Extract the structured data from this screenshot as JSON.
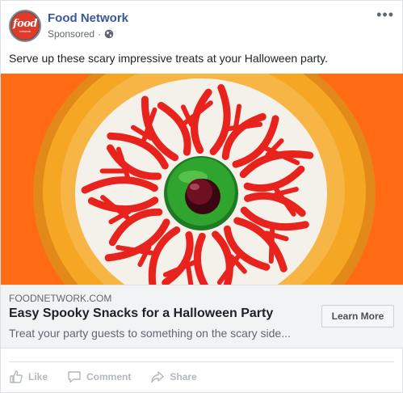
{
  "post": {
    "page_name": "Food Network",
    "sponsored": "Sponsored",
    "separator": "·",
    "caption": "Serve up these scary impressive treats at your Halloween party.",
    "avatar_logo": "food",
    "avatar_sub": "network",
    "more_label": "•••"
  },
  "link": {
    "domain": "FOODNETWORK.COM",
    "headline": "Easy Spooky Snacks for a Halloween Party",
    "description": "Treat your party guests to something on the scary side...",
    "cta": "Learn More"
  },
  "actions": {
    "like": "Like",
    "comment": "Comment",
    "share": "Share"
  },
  "colors": {
    "page_link": "#385898",
    "image_background": "#ff6a13",
    "bowl": "#f5a623",
    "accent_red": "#e8231e",
    "eye_green": "#2fa52f"
  },
  "icons": [
    "more-options-icon",
    "globe-icon",
    "like-icon",
    "comment-icon",
    "share-icon"
  ]
}
